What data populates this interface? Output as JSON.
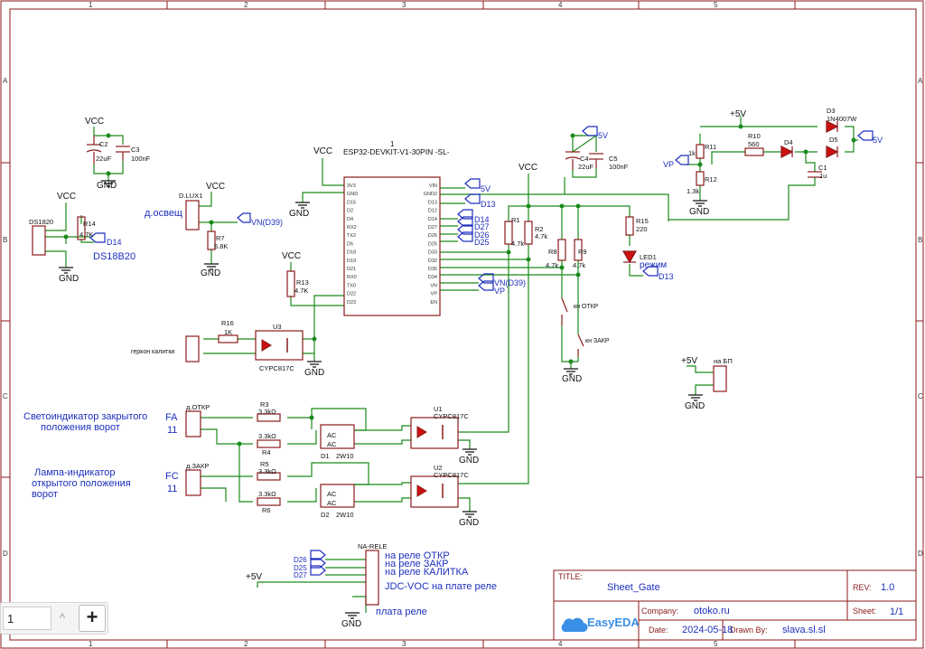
{
  "frame": {
    "col_labels": [
      "1",
      "2",
      "3",
      "4",
      "5"
    ],
    "row_labels": [
      "A",
      "B",
      "C",
      "D"
    ]
  },
  "power": {
    "vcc": "VCC",
    "gnd": "GND",
    "p5v": "+5V",
    "net5v": "5V"
  },
  "mcu": {
    "ref": "1",
    "name": "ESP32-DEVKIT-V1-30PIN -SL-",
    "left_pins": [
      "3V3",
      "GND",
      "D15",
      "D2",
      "D4",
      "RX2",
      "TX2",
      "D5",
      "D18",
      "D19",
      "D21",
      "RX0",
      "TX0",
      "D22",
      "D23"
    ],
    "right_pins": [
      "VIN",
      "GND2",
      "D13",
      "D12",
      "D14",
      "D27",
      "D26",
      "D25",
      "D33",
      "D32",
      "D35",
      "D34",
      "VN",
      "VP",
      "EN"
    ]
  },
  "nets": {
    "vn": "VN(D39)",
    "vp": "VP",
    "d13": "D13",
    "d14": "D14",
    "d27": "D27",
    "d26": "D26",
    "d25": "D25",
    "d2": "D2",
    "d5": "D5"
  },
  "components": {
    "c2": {
      "ref": "C2",
      "val": "22uF"
    },
    "c3": {
      "ref": "C3",
      "val": "100nF"
    },
    "c4": {
      "ref": "C4",
      "val": "22uF"
    },
    "c5": {
      "ref": "C5",
      "val": "100nF"
    },
    "c1": {
      "ref": "C1",
      "val": "1u"
    },
    "ds": {
      "ref": "DS1820"
    },
    "r14": {
      "ref": "R14",
      "val": "4.7K"
    },
    "lux": {
      "ref": "D.LUX1"
    },
    "r7": {
      "ref": "R7",
      "val": "6.8K"
    },
    "r13": {
      "ref": "R13",
      "val": "4.7K"
    },
    "r16": {
      "ref": "R16",
      "val": "1K"
    },
    "u3": {
      "ref": "U3",
      "val": "CYPC817C"
    },
    "r1": {
      "ref": "R1",
      "val": "4.7k"
    },
    "r2": {
      "ref": "R2",
      "val": "4.7k"
    },
    "r8": {
      "ref": "R8",
      "val": "4.7k"
    },
    "r9": {
      "ref": "R9",
      "val": "4.7k"
    },
    "r15": {
      "ref": "R15",
      "val": "220"
    },
    "led1": {
      "ref": "LED1",
      "val": "режим"
    },
    "r11": {
      "ref": "R11",
      "val": "1k"
    },
    "r12": {
      "ref": "R12",
      "val": "1.3k"
    },
    "r10": {
      "ref": "R10",
      "val": "560"
    },
    "d3": {
      "ref": "D3",
      "val": "1N4007W"
    },
    "d4": {
      "ref": "D4"
    },
    "d5": {
      "ref": "D5"
    },
    "r3": {
      "ref": "R3",
      "val": "3.3kΩ"
    },
    "r4": {
      "ref": "R4",
      "val": "3.3kΩ"
    },
    "r5": {
      "ref": "R5",
      "val": "3.3kΩ"
    },
    "r6": {
      "ref": "R6",
      "val": "3.3kΩ"
    },
    "d1": {
      "ref": "D1",
      "val": "2W10"
    },
    "d2": {
      "ref": "D2",
      "val": "2W10"
    },
    "u1": {
      "ref": "U1",
      "val": "CYPC817C"
    },
    "u2": {
      "ref": "U2",
      "val": "CYPC817C"
    },
    "dotkr": {
      "ref": "д.ОТКР"
    },
    "dzakr": {
      "ref": "д.ЗАКР"
    },
    "narele": {
      "ref": "NA-RELE"
    },
    "nabp": {
      "ref": "на БП"
    }
  },
  "labels": {
    "ds18b20": "DS18B20",
    "osvesh": "д.освещ",
    "gerkon": "геркон калитки",
    "kn_otkr": "кн ОТКР",
    "kn_zakr": "кн ЗАКР",
    "svet": [
      "Светоиндикатор закрытого",
      "положения ворот"
    ],
    "fa": "FA",
    "n11a": "11",
    "lamp": [
      "Лампа-индикатор",
      "открытого положения",
      "ворот"
    ],
    "fc": "FC",
    "n11c": "11",
    "rele_otkr": "на реле ОТКР",
    "rele_zakr": "на реле ЗАКР",
    "rele_kalit": "на реле КАЛИТКА",
    "jdc": "JDC-VOC на плате реле",
    "plata": "плата реле",
    "ac": "AC"
  },
  "title_block": {
    "title_label": "TITLE:",
    "title": "Sheet_Gate",
    "rev_label": "REV:",
    "rev": "1.0",
    "company_label": "Company:",
    "company": "otoko.ru",
    "sheet_label": "Sheet:",
    "sheet": "1/1",
    "date_label": "Date:",
    "date": "2024-05-18",
    "drawn_label": "Drawn By:",
    "drawn": "slava.sl.sl",
    "logo": "EasyEDA"
  },
  "zoom": {
    "value": "1",
    "up": "^",
    "plus": "+"
  },
  "colors": {
    "wire": "#1a8a1a",
    "comp": "#8b1a1a",
    "net": "#1d2fbd",
    "text": "#111111",
    "frame": "#8b1a1a"
  }
}
